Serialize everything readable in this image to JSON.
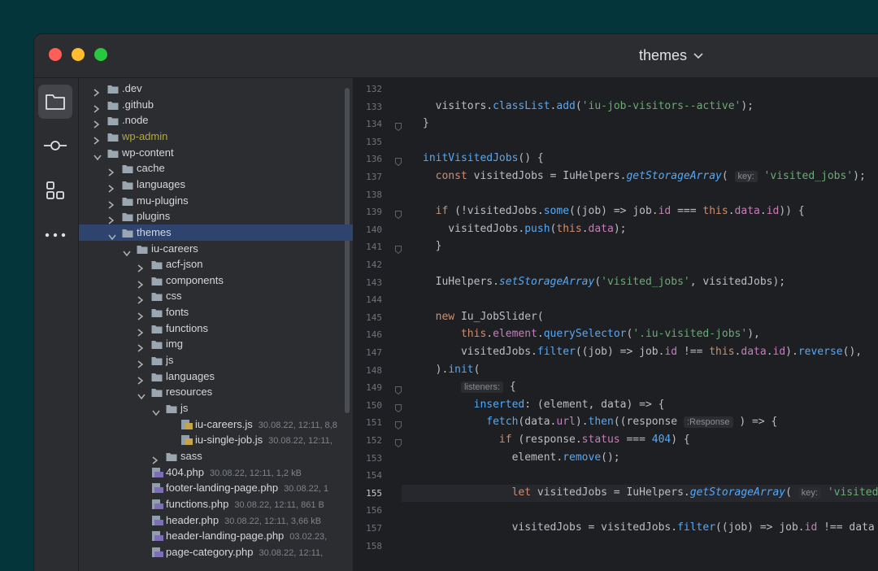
{
  "window": {
    "title": "themes"
  },
  "toolstrip": [
    "folder-icon",
    "commit-icon",
    "structure-icon",
    "more-icon"
  ],
  "tree": [
    {
      "label": ".dev",
      "depth": 0,
      "type": "folder",
      "expanded": false
    },
    {
      "label": ".github",
      "depth": 0,
      "type": "folder",
      "expanded": false
    },
    {
      "label": ".node",
      "depth": 0,
      "type": "folder",
      "expanded": false
    },
    {
      "label": "wp-admin",
      "depth": 0,
      "type": "folder",
      "expanded": false,
      "excluded": true
    },
    {
      "label": "wp-content",
      "depth": 0,
      "type": "folder",
      "expanded": true
    },
    {
      "label": "cache",
      "depth": 1,
      "type": "folder",
      "expanded": false
    },
    {
      "label": "languages",
      "depth": 1,
      "type": "folder",
      "expanded": false
    },
    {
      "label": "mu-plugins",
      "depth": 1,
      "type": "folder",
      "expanded": false
    },
    {
      "label": "plugins",
      "depth": 1,
      "type": "folder",
      "expanded": false
    },
    {
      "label": "themes",
      "depth": 1,
      "type": "folder",
      "expanded": true,
      "selected": true
    },
    {
      "label": "iu-careers",
      "depth": 2,
      "type": "folder",
      "expanded": true
    },
    {
      "label": "acf-json",
      "depth": 3,
      "type": "folder",
      "expanded": false
    },
    {
      "label": "components",
      "depth": 3,
      "type": "folder",
      "expanded": false
    },
    {
      "label": "css",
      "depth": 3,
      "type": "folder",
      "expanded": false
    },
    {
      "label": "fonts",
      "depth": 3,
      "type": "folder",
      "expanded": false
    },
    {
      "label": "functions",
      "depth": 3,
      "type": "folder",
      "expanded": false
    },
    {
      "label": "img",
      "depth": 3,
      "type": "folder",
      "expanded": false
    },
    {
      "label": "js",
      "depth": 3,
      "type": "folder",
      "expanded": false
    },
    {
      "label": "languages",
      "depth": 3,
      "type": "folder",
      "expanded": false
    },
    {
      "label": "resources",
      "depth": 3,
      "type": "folder",
      "expanded": true
    },
    {
      "label": "js",
      "depth": 4,
      "type": "folder",
      "expanded": true
    },
    {
      "label": "iu-careers.js",
      "depth": 5,
      "type": "js",
      "meta": "30.08.22, 12:11, 8,8"
    },
    {
      "label": "iu-single-job.js",
      "depth": 5,
      "type": "js",
      "meta": "30.08.22, 12:11,"
    },
    {
      "label": "sass",
      "depth": 4,
      "type": "folder",
      "expanded": false
    },
    {
      "label": "404.php",
      "depth": 3,
      "type": "php",
      "meta": "30.08.22, 12:11, 1,2 kB"
    },
    {
      "label": "footer-landing-page.php",
      "depth": 3,
      "type": "php",
      "meta": "30.08.22, 1"
    },
    {
      "label": "functions.php",
      "depth": 3,
      "type": "php",
      "meta": "30.08.22, 12:11, 861 B"
    },
    {
      "label": "header.php",
      "depth": 3,
      "type": "php",
      "meta": "30.08.22, 12:11, 3,66 kB"
    },
    {
      "label": "header-landing-page.php",
      "depth": 3,
      "type": "php",
      "meta": "03.02.23,"
    },
    {
      "label": "page-category.php",
      "depth": 3,
      "type": "php",
      "meta": "30.08.22, 12:11,"
    }
  ],
  "editor": {
    "current_line": "155",
    "lines": [
      {
        "n": "132",
        "html": ""
      },
      {
        "n": "133",
        "html": "  visitors.<span class=\"mt\">classList</span>.<span class=\"fn\">add</span>(<span class=\"st\">'iu-job-visitors--active'</span>);"
      },
      {
        "n": "134",
        "html": "}"
      },
      {
        "n": "135",
        "html": ""
      },
      {
        "n": "136",
        "html": "<span class=\"fn\">initVisitedJobs</span>() {"
      },
      {
        "n": "137",
        "html": "  <span class=\"kw\">const</span> visitedJobs = IuHelpers.<span class=\"it\">getStorageArray</span>( <span class=\"hint\">key:</span> <span class=\"st\">'visited_jobs'</span>);"
      },
      {
        "n": "138",
        "html": ""
      },
      {
        "n": "139",
        "html": "  <span class=\"kw\">if</span> (!visitedJobs.<span class=\"fn\">some</span>((job) => job.<span class=\"pr\">id</span> === <span class=\"kw\">this</span>.<span class=\"pr\">data</span>.<span class=\"pr\">id</span>)) {"
      },
      {
        "n": "140",
        "html": "    visitedJobs.<span class=\"fn\">push</span>(<span class=\"kw\">this</span>.<span class=\"pr\">data</span>);"
      },
      {
        "n": "141",
        "html": "  }"
      },
      {
        "n": "142",
        "html": ""
      },
      {
        "n": "143",
        "html": "  IuHelpers.<span class=\"it\">setStorageArray</span>(<span class=\"st\">'visited_jobs'</span>, visitedJobs);"
      },
      {
        "n": "144",
        "html": ""
      },
      {
        "n": "145",
        "html": "  <span class=\"kw\">new</span> Iu_JobSlider("
      },
      {
        "n": "146",
        "html": "      <span class=\"kw\">this</span>.<span class=\"pr\">element</span>.<span class=\"fn\">querySelector</span>(<span class=\"st\">'.iu-visited-jobs'</span>),"
      },
      {
        "n": "147",
        "html": "      visitedJobs.<span class=\"fn\">filter</span>((job) => job.<span class=\"pr\">id</span> !== <span class=\"kw\">this</span>.<span class=\"pr\">data</span>.<span class=\"pr\">id</span>).<span class=\"fn\">reverse</span>(),"
      },
      {
        "n": "148",
        "html": "  ).<span class=\"fn\">init</span>("
      },
      {
        "n": "149",
        "html": "      <span class=\"hint\">listeners:</span> {"
      },
      {
        "n": "150",
        "html": "        <span class=\"fn\">inserted</span>: (element, data) => {"
      },
      {
        "n": "151",
        "html": "          <span class=\"fn\">fetch</span>(data.<span class=\"pr\">url</span>).<span class=\"fn\">then</span>((response <span class=\"hint\">:Response</span> ) => {"
      },
      {
        "n": "152",
        "html": "            <span class=\"kw\">if</span> (response.<span class=\"pr\">status</span> === <span class=\"fn\">404</span>) {"
      },
      {
        "n": "153",
        "html": "              element.<span class=\"fn\">remove</span>();"
      },
      {
        "n": "154",
        "html": ""
      },
      {
        "n": "155",
        "html": "              <span class=\"kw\">let</span> visitedJobs = IuHelpers.<span class=\"it\">getStorageArray</span>( <span class=\"hint\">key:</span> <span class=\"st\">'visited_</span>"
      },
      {
        "n": "156",
        "html": ""
      },
      {
        "n": "157",
        "html": "              visitedJobs = visitedJobs.<span class=\"fn\">filter</span>((job) => job.<span class=\"pr\">id</span> !== data"
      },
      {
        "n": "158",
        "html": ""
      }
    ],
    "fold_lines": [
      "134",
      "136",
      "139",
      "141",
      "149",
      "150",
      "151",
      "152"
    ]
  }
}
